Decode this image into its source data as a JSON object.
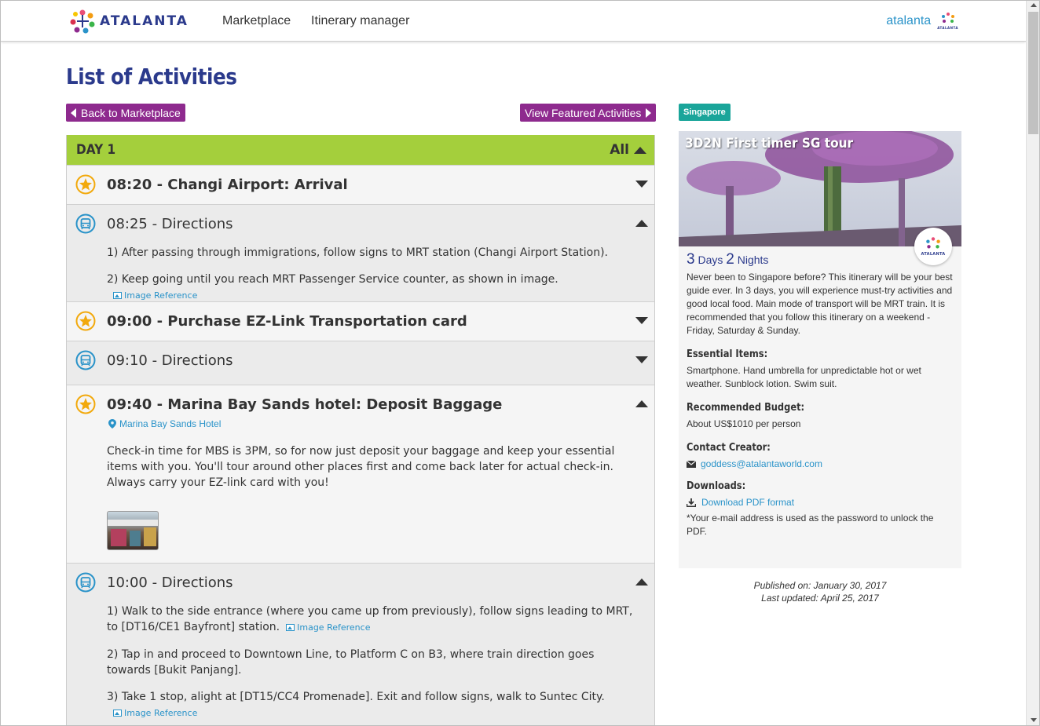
{
  "header": {
    "logo_text": "ATALANTA",
    "nav": [
      "Marketplace",
      "Itinerary manager"
    ],
    "user_name": "atalanta",
    "user_logo_text": "ATALANTA"
  },
  "page": {
    "title": "List of Activities",
    "back_button": "Back to Marketplace",
    "featured_button": "View Featured Activities"
  },
  "day": {
    "label": "DAY 1",
    "toggle_label": "All"
  },
  "rows": [
    {
      "time_title": "08:20 - Changi Airport: Arrival"
    },
    {
      "time_title": "08:25 - Directions",
      "steps": [
        "1) After passing through immigrations, follow signs to MRT station (Changi Airport Station).",
        "2) Keep going until you reach MRT Passenger Service counter, as shown in image."
      ],
      "image_ref": "Image Reference"
    },
    {
      "time_title": "09:00 - Purchase EZ-Link Transportation card"
    },
    {
      "time_title": "09:10 - Directions"
    },
    {
      "time_title": "09:40 - Marina Bay Sands hotel: Deposit Baggage",
      "location": "Marina Bay Sands Hotel",
      "description": "Check-in time for MBS is 3PM, so for now just deposit your baggage and keep your essential items with you. You'll tour around other places first and come back later for actual check-in. Always carry your EZ-link card with you!"
    },
    {
      "time_title": "10:00 - Directions",
      "steps": [
        "1) Walk to the side entrance (where you came up from previously), follow signs leading to MRT, to [DT16/CE1 Bayfront] station.",
        "2) Tap in and proceed to Downtown Line, to Platform C on B3, where train direction goes towards [Bukit Panjang].",
        "3) Take 1 stop, alight at [DT15/CC4 Promenade]. Exit and follow signs, walk to Suntec City."
      ],
      "image_ref": "Image Reference"
    }
  ],
  "sidebar": {
    "location_tag": "Singapore",
    "tour_title": "3D2N First timer SG tour",
    "badge_text": "ATALANTA",
    "days_num": "3",
    "days_label": "Days",
    "nights_num": "2",
    "nights_label": "Nights",
    "description": "Never been to Singapore before? This itinerary will be your best guide ever. In 3 days, you will experience must-try activities and good local food. Main mode of transport will be MRT train. It is recommended that you follow this itinerary on a weekend - Friday, Saturday & Sunday.",
    "essential_heading": "Essential Items:",
    "essential_value": "Smartphone. Hand umbrella for unpredictable hot or wet weather. Sunblock lotion. Swim suit.",
    "budget_heading": "Recommended Budget:",
    "budget_value": "About US$1010 per person",
    "contact_heading": "Contact Creator:",
    "contact_email": "goddess@atalantaworld.com",
    "downloads_heading": "Downloads:",
    "download_link": "Download PDF format",
    "download_note": "*Your e-mail address is used as the password to unlock the PDF.",
    "published": "Published on: January 30, 2017",
    "updated": "Last updated: April 25, 2017"
  },
  "colors": {
    "brand_blue": "#2b3a8c",
    "purple_button": "#8e2a8e",
    "day_green": "#a4cf3c",
    "teal_tag": "#1aa59a",
    "link_blue": "#2a93c9",
    "star_orange": "#f2a90c"
  },
  "icons": {
    "activity": "star-icon",
    "directions": "bus-icon",
    "location": "map-pin-icon",
    "image": "image-icon",
    "email": "envelope-icon",
    "download": "download-icon"
  }
}
